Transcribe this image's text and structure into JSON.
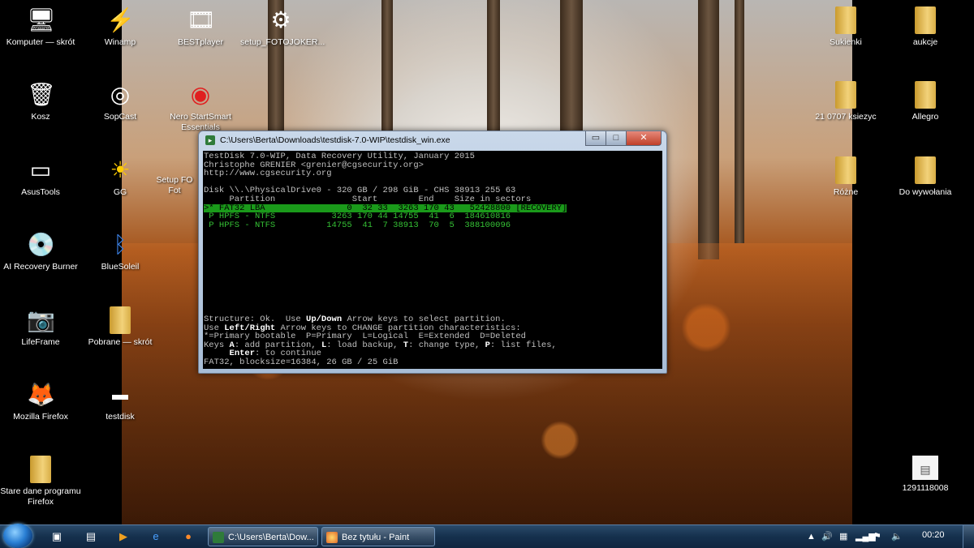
{
  "desktop": {
    "left_icons": [
      {
        "label": "Komputer — skrót",
        "icon": "computer-icon"
      },
      {
        "label": "Kosz",
        "icon": "recycle-bin-icon"
      },
      {
        "label": "AsusTools",
        "icon": "asus-icon"
      },
      {
        "label": "AI Recovery Burner",
        "icon": "disc-icon"
      },
      {
        "label": "LifeFrame",
        "icon": "camera-icon"
      },
      {
        "label": "Mozilla Firefox",
        "icon": "firefox-icon"
      },
      {
        "label": "Stare dane programu Firefox",
        "icon": "folder-icon"
      }
    ],
    "col2_icons": [
      {
        "label": "Winamp",
        "icon": "winamp-icon"
      },
      {
        "label": "SopCast",
        "icon": "sopcast-icon"
      },
      {
        "label": "GG",
        "icon": "gg-icon"
      },
      {
        "label": "BlueSoleil",
        "icon": "bluetooth-icon"
      },
      {
        "label": "Pobrane — skrót",
        "icon": "folder-icon"
      },
      {
        "label": "testdisk",
        "icon": "terminal-icon"
      }
    ],
    "top_icons": [
      {
        "label": "BESTplayer",
        "icon": "film-icon"
      },
      {
        "label": "setup_FOTOJOKER...",
        "icon": "setup-icon"
      },
      {
        "label": "Nero StartSmart Essentials",
        "icon": "nero-icon"
      },
      {
        "label": "Setup FO Fot",
        "icon": "setup-icon"
      }
    ],
    "right_icons": [
      {
        "label": "Sukienki",
        "icon": "folder-icon"
      },
      {
        "label": "aukcje",
        "icon": "folder-icon"
      },
      {
        "label": "21 0707 ksiezyc",
        "icon": "folder-icon"
      },
      {
        "label": "Allegro",
        "icon": "folder-icon"
      },
      {
        "label": "Różne",
        "icon": "folder-icon"
      },
      {
        "label": "Do wywołania",
        "icon": "folder-icon"
      },
      {
        "label": "1291118008",
        "icon": "image-file-icon"
      }
    ]
  },
  "window": {
    "title": "C:\\Users\\Berta\\Downloads\\testdisk-7.0-WIP\\testdisk_win.exe",
    "minimize": "▭",
    "maximize": "□",
    "close": "✕"
  },
  "console": {
    "header1": "TestDisk 7.0-WIP, Data Recovery Utility, January 2015",
    "header2": "Christophe GRENIER <grenier@cgsecurity.org>",
    "header3": "http://www.cgsecurity.org",
    "disk": "Disk \\\\.\\PhysicalDrive0 - 320 GB / 298 GiB - CHS 38913 255 63",
    "columns": "     Partition               Start        End    Size in sectors",
    "rows": [
      ">* FAT32 LBA                0  32 33  3263 170 43   52428800 [RECOVERY]",
      " P HPFS - NTFS           3263 170 44 14755  41  6  184610816",
      " P HPFS - NTFS          14755  41  7 38913  70  5  388100096"
    ],
    "help1_a": "Structure: Ok.  Use ",
    "help1_b": "Up/Down",
    "help1_c": " Arrow keys to select partition.",
    "help2_a": "Use ",
    "help2_b": "Left/Right",
    "help2_c": " Arrow keys to CHANGE partition characteristics:",
    "help3": "*=Primary bootable  P=Primary  L=Logical  E=Extended  D=Deleted",
    "help4_a": "Keys ",
    "help4_b": "A",
    "help4_c": ": add partition, ",
    "help4_d": "L",
    "help4_e": ": load backup, ",
    "help4_f": "T",
    "help4_g": ": change type, ",
    "help4_h": "P",
    "help4_i": ": list files,",
    "help5_a": "     ",
    "help5_b": "Enter",
    "help5_c": ": to continue",
    "status": "FAT32, blocksize=16384, 26 GB / 25 GiB"
  },
  "taskbar": {
    "buttons": [
      {
        "label": "C:\\Users\\Berta\\Dow...",
        "icon": "console-icon"
      },
      {
        "label": "Bez tytułu - Paint",
        "icon": "paint-icon"
      }
    ],
    "clock": "00:20"
  }
}
